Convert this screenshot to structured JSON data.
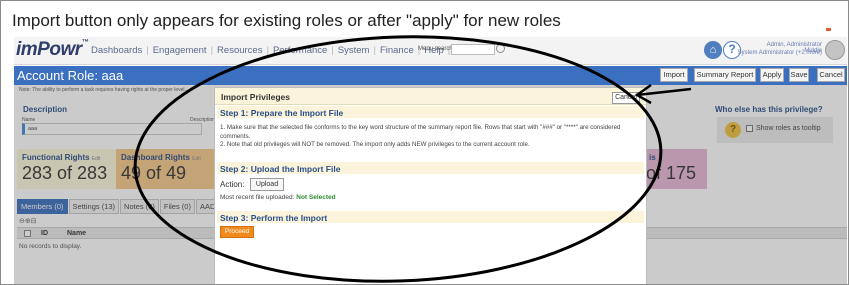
{
  "caption": "Import button only appears for existing roles or after \"apply\" for new roles",
  "header": {
    "logo": "imPowr",
    "logo_mark": "™",
    "nav": [
      "Dashboards",
      "Engagement",
      "Resources",
      "Performance",
      "System",
      "Finance",
      "Help"
    ],
    "menu_search_label": "Menu search:",
    "user_name": "Admin, Administrator Middle",
    "user_role": "System Administrator (+2 more)",
    "home_icon": "⌂",
    "help_icon": "?"
  },
  "title_bar": {
    "title": "Account Role: aaa",
    "buttons": {
      "import": "Import",
      "summary": "Summary Report",
      "apply": "Apply",
      "save": "Save",
      "cancel": "Cancel"
    }
  },
  "note": "Note: The ability to perform a task requires having rights at the proper level...",
  "description": {
    "heading": "Description",
    "name_label": "Name",
    "name_value": "aaa",
    "descr_label": "Description"
  },
  "rights": {
    "functional": {
      "title": "Functional Rights",
      "tag": "Edit",
      "count": "283 of 283"
    },
    "dashboard": {
      "title": "Dashboard Rights",
      "tag": "Edit",
      "count": "49 of 49"
    },
    "other": {
      "title": "is",
      "count": "of 175"
    }
  },
  "who_else": {
    "heading": "Who else has this privilege?",
    "checkbox_label": "Show roles as tooltip",
    "icon": "?"
  },
  "tabs": [
    "Members (0)",
    "Settings (13)",
    "Notes (0)",
    "Files (0)",
    "AAD G"
  ],
  "grid": {
    "tools": "⊖⊕⊟",
    "columns": [
      "ID",
      "Name"
    ],
    "empty_message": "No records to display."
  },
  "modal": {
    "title": "Import Privileges",
    "cancel": "Cancel",
    "step1": {
      "title": "Step 1: Prepare the Import File",
      "text1": "1. Make sure that the selected file conforms to the key word structure of the summary report file. Rows that start with \"###\" or \"****\" are considered comments.",
      "text2": "2. Note that old privileges will NOT be removed. The import only adds NEW privileges to the current account role."
    },
    "step2": {
      "title": "Step 2: Upload the Import File",
      "action_label": "Action:",
      "upload": "Upload",
      "recent_label": "Most recent file uploaded:",
      "recent_value": "Not Selected"
    },
    "step3": {
      "title": "Step 3: Perform the Import",
      "proceed": "Proceed"
    }
  },
  "colors": {
    "brand_blue": "#3b6fbf",
    "proceed_orange": "#f08a1c",
    "not_selected_green": "#2e8b2e"
  }
}
